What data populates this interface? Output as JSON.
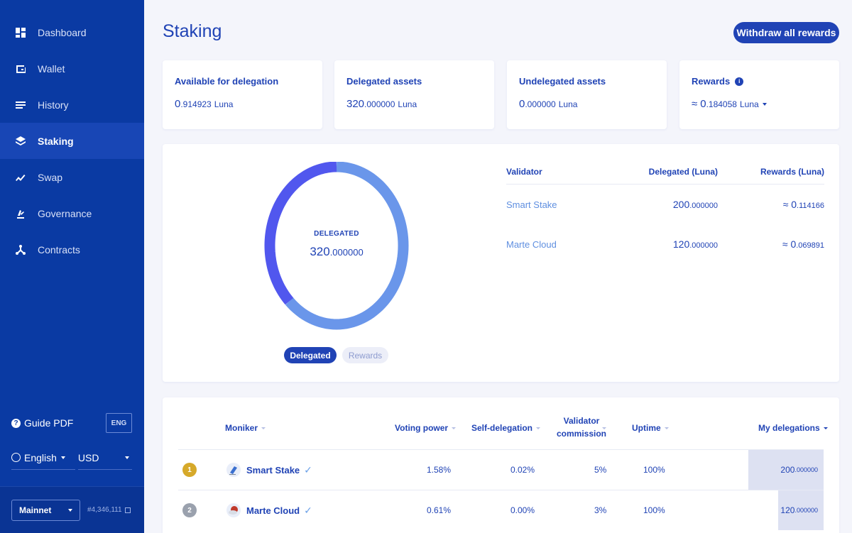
{
  "sidebar": {
    "items": [
      {
        "label": "Dashboard",
        "icon": "dashboard-icon"
      },
      {
        "label": "Wallet",
        "icon": "wallet-icon"
      },
      {
        "label": "History",
        "icon": "history-icon"
      },
      {
        "label": "Staking",
        "icon": "staking-icon",
        "active": true
      },
      {
        "label": "Swap",
        "icon": "swap-icon"
      },
      {
        "label": "Governance",
        "icon": "governance-icon"
      },
      {
        "label": "Contracts",
        "icon": "contracts-icon"
      }
    ],
    "guide_label": "Guide PDF",
    "guide_lang": "ENG",
    "language": "English",
    "currency": "USD",
    "network": "Mainnet",
    "block": "#4,346,111"
  },
  "header": {
    "title": "Staking",
    "withdraw_label": "Withdraw all rewards"
  },
  "stats": [
    {
      "label": "Available for delegation",
      "int": "0",
      "dec": ".914923",
      "unit": "Luna",
      "approx": ""
    },
    {
      "label": "Delegated assets",
      "int": "320",
      "dec": ".000000",
      "unit": "Luna",
      "approx": ""
    },
    {
      "label": "Undelegated assets",
      "int": "0",
      "dec": ".000000",
      "unit": "Luna",
      "approx": ""
    },
    {
      "label": "Rewards",
      "int": "0",
      "dec": ".184058",
      "unit": "Luna",
      "approx": "≈"
    }
  ],
  "chart": {
    "center_title": "DELEGATED",
    "center_int": "320",
    "center_dec": ".000000",
    "toggle_on": "Delegated",
    "toggle_off": "Rewards"
  },
  "chart_data": {
    "type": "pie",
    "categories": [
      "Smart Stake",
      "Marte Cloud"
    ],
    "values": [
      200,
      120
    ],
    "colors": [
      "#6a96ea",
      "#5157ee"
    ],
    "donut": true
  },
  "validators_summary": {
    "headers": [
      "Validator",
      "Delegated (Luna)",
      "Rewards (Luna)"
    ],
    "rows": [
      {
        "name": "Smart Stake",
        "del_int": "200",
        "del_dec": ".000000",
        "rew_int": "≈ 0",
        "rew_dec": ".114166"
      },
      {
        "name": "Marte Cloud",
        "del_int": "120",
        "del_dec": ".000000",
        "rew_int": "≈ 0",
        "rew_dec": ".069891"
      }
    ]
  },
  "validators_table": {
    "headers": {
      "moniker": "Moniker",
      "voting": "Voting power",
      "self": "Self-delegation",
      "commission_1": "Validator",
      "commission_2": "commission",
      "uptime": "Uptime",
      "mine": "My delegations"
    },
    "rows": [
      {
        "rank": "1",
        "rank_color": "#d6a92a",
        "name": "Smart Stake",
        "voting": "1.58%",
        "self": "0.02%",
        "commission": "5%",
        "uptime": "100%",
        "mine_int": "200",
        "mine_dec": ".000000",
        "mine_share": 1.0
      },
      {
        "rank": "2",
        "rank_color": "#9aa1ad",
        "name": "Marte Cloud",
        "voting": "0.61%",
        "self": "0.00%",
        "commission": "3%",
        "uptime": "100%",
        "mine_int": "120",
        "mine_dec": ".000000",
        "mine_share": 0.6
      }
    ]
  }
}
